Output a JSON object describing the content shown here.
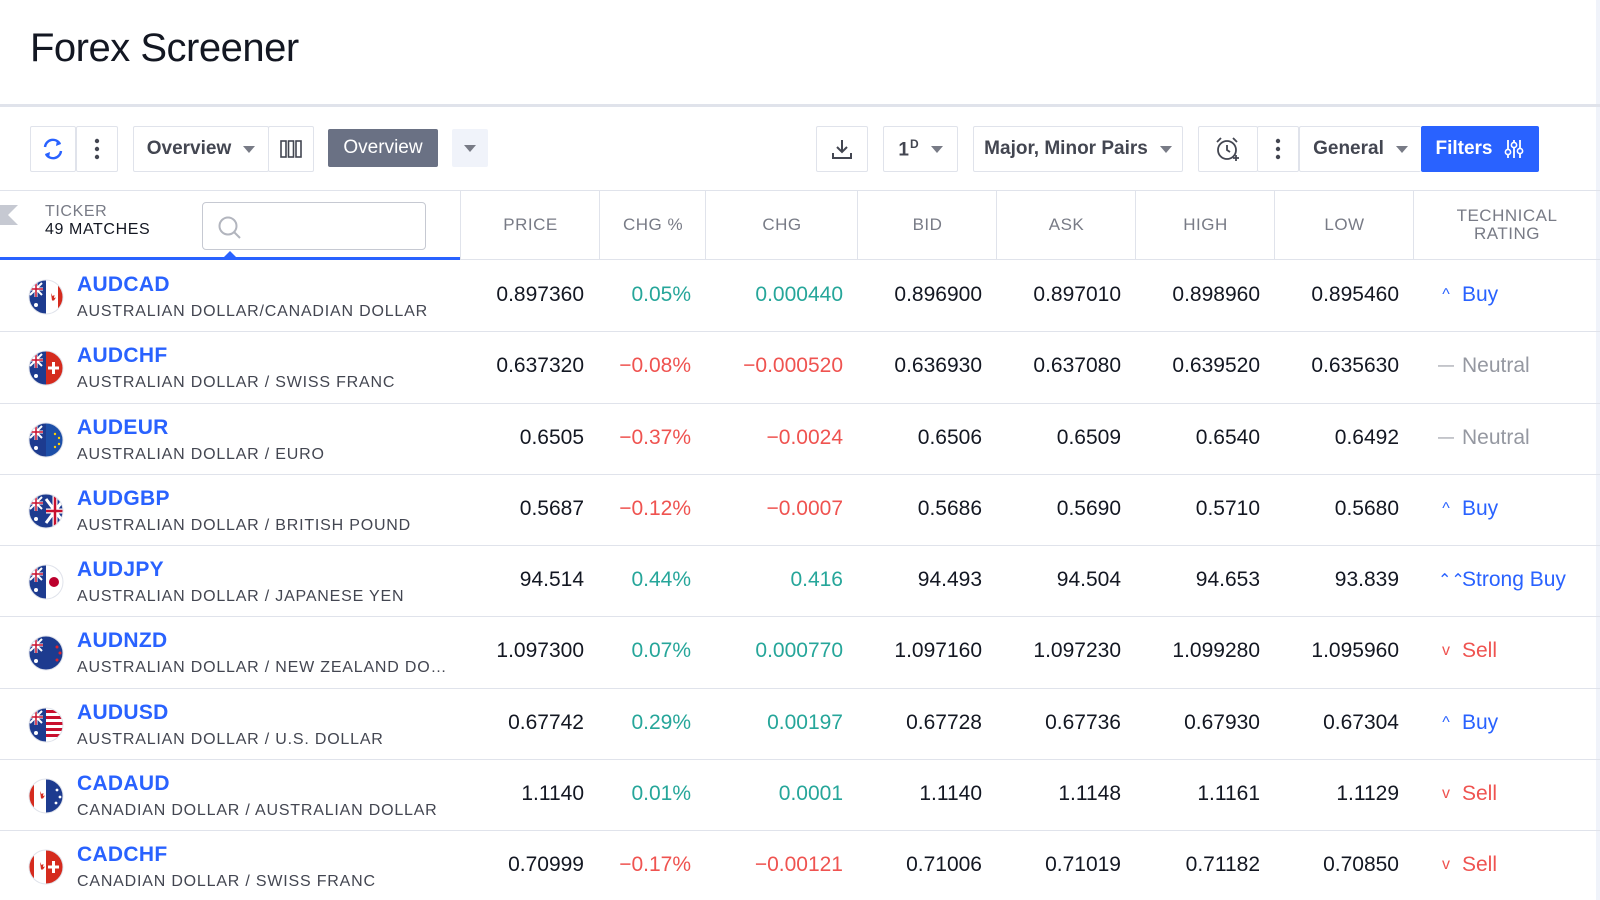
{
  "page": {
    "title": "Forex Screener"
  },
  "toolbar": {
    "overview_dropdown": "Overview",
    "overview_active": "Overview",
    "interval": "1",
    "interval_sup": "D",
    "pairs_filter": "Major, Minor Pairs",
    "general": "General",
    "filters": "Filters"
  },
  "table": {
    "ticker_label": "TICKER",
    "matches": "49 MATCHES",
    "search_placeholder": "",
    "columns": [
      "PRICE",
      "CHG %",
      "CHG",
      "BID",
      "ASK",
      "HIGH",
      "LOW",
      "TECHNICAL RATING"
    ],
    "rows": [
      {
        "symbol": "AUDCAD",
        "name": "AUSTRALIAN DOLLAR/CANADIAN DOLLAR",
        "flag2": "ca",
        "price": "0.897360",
        "chg_pct": "0.05%",
        "chg": "0.000440",
        "dir": "pos",
        "bid": "0.896900",
        "ask": "0.897010",
        "high": "0.898960",
        "low": "0.895460",
        "rating": "Buy",
        "rating_type": "buy",
        "rating_icon": "^"
      },
      {
        "symbol": "AUDCHF",
        "name": "AUSTRALIAN DOLLAR / SWISS FRANC",
        "flag2": "ch",
        "price": "0.637320",
        "chg_pct": "−0.08%",
        "chg": "−0.000520",
        "dir": "neg",
        "bid": "0.636930",
        "ask": "0.637080",
        "high": "0.639520",
        "low": "0.635630",
        "rating": "Neutral",
        "rating_type": "neutral",
        "rating_icon": "—"
      },
      {
        "symbol": "AUDEUR",
        "name": "AUSTRALIAN DOLLAR / EURO",
        "flag2": "eu",
        "price": "0.6505",
        "chg_pct": "−0.37%",
        "chg": "−0.0024",
        "dir": "neg",
        "bid": "0.6506",
        "ask": "0.6509",
        "high": "0.6540",
        "low": "0.6492",
        "rating": "Neutral",
        "rating_type": "neutral",
        "rating_icon": "—"
      },
      {
        "symbol": "AUDGBP",
        "name": "AUSTRALIAN DOLLAR / BRITISH POUND",
        "flag2": "gb",
        "price": "0.5687",
        "chg_pct": "−0.12%",
        "chg": "−0.0007",
        "dir": "neg",
        "bid": "0.5686",
        "ask": "0.5690",
        "high": "0.5710",
        "low": "0.5680",
        "rating": "Buy",
        "rating_type": "buy",
        "rating_icon": "^"
      },
      {
        "symbol": "AUDJPY",
        "name": "AUSTRALIAN DOLLAR / JAPANESE YEN",
        "flag2": "jp",
        "price": "94.514",
        "chg_pct": "0.44%",
        "chg": "0.416",
        "dir": "pos",
        "bid": "94.493",
        "ask": "94.504",
        "high": "94.653",
        "low": "93.839",
        "rating": "Strong Buy",
        "rating_type": "buy",
        "rating_icon": "⌃⌃"
      },
      {
        "symbol": "AUDNZD",
        "name": "AUSTRALIAN DOLLAR / NEW ZEALAND DO…",
        "flag2": "nz",
        "price": "1.097300",
        "chg_pct": "0.07%",
        "chg": "0.000770",
        "dir": "pos",
        "bid": "1.097160",
        "ask": "1.097230",
        "high": "1.099280",
        "low": "1.095960",
        "rating": "Sell",
        "rating_type": "sell",
        "rating_icon": "v"
      },
      {
        "symbol": "AUDUSD",
        "name": "AUSTRALIAN DOLLAR / U.S. DOLLAR",
        "flag2": "us",
        "price": "0.67742",
        "chg_pct": "0.29%",
        "chg": "0.00197",
        "dir": "pos",
        "bid": "0.67728",
        "ask": "0.67736",
        "high": "0.67930",
        "low": "0.67304",
        "rating": "Buy",
        "rating_type": "buy",
        "rating_icon": "^"
      },
      {
        "symbol": "CADAUD",
        "name": "CANADIAN DOLLAR / AUSTRALIAN DOLLAR",
        "flag2": "au",
        "flag1": "ca",
        "price": "1.1140",
        "chg_pct": "0.01%",
        "chg": "0.0001",
        "dir": "pos",
        "bid": "1.1140",
        "ask": "1.1148",
        "high": "1.1161",
        "low": "1.1129",
        "rating": "Sell",
        "rating_type": "sell",
        "rating_icon": "v"
      },
      {
        "symbol": "CADCHF",
        "name": "CANADIAN DOLLAR / SWISS FRANC",
        "flag2": "ch",
        "flag1": "ca",
        "price": "0.70999",
        "chg_pct": "−0.17%",
        "chg": "−0.00121",
        "dir": "neg",
        "bid": "0.71006",
        "ask": "0.71019",
        "high": "0.71182",
        "low": "0.70850",
        "rating": "Sell",
        "rating_type": "sell",
        "rating_icon": "v"
      }
    ]
  },
  "colors": {
    "accent": "#2962ff",
    "positive": "#26a69a",
    "negative": "#ef5350",
    "neutral": "#9598a1"
  }
}
